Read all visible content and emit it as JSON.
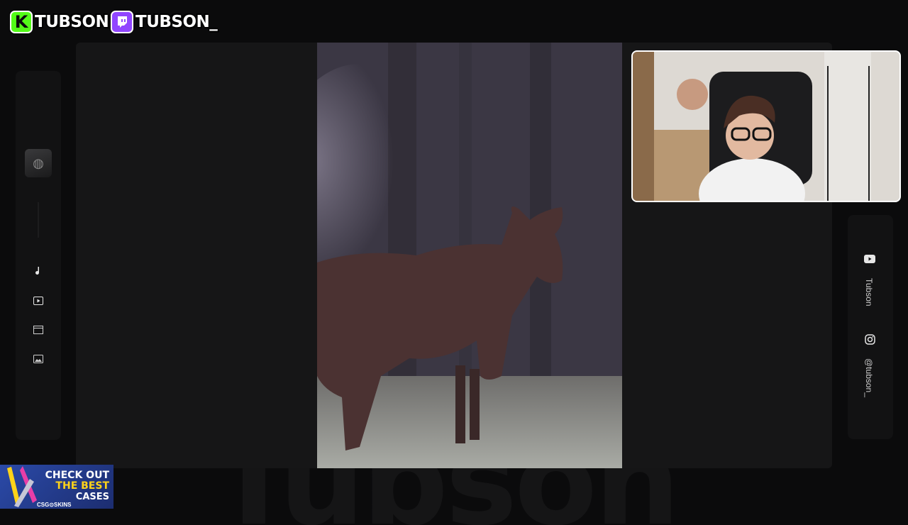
{
  "header": {
    "kick": {
      "badge": "K",
      "handle": "TUBSON",
      "color": "#53fc18"
    },
    "twitch": {
      "badge": "",
      "handle": "TUBSON_",
      "color": "#9146ff"
    }
  },
  "watermark": "Tubson",
  "left_rail": {
    "icons": [
      "avatar-thumbnail",
      "music-note-icon",
      "play-video-icon",
      "clapperboard-icon",
      "image-icon"
    ]
  },
  "right_rail": {
    "youtube": {
      "icon": "youtube-icon",
      "label": "Tubson"
    },
    "instagram": {
      "icon": "instagram-icon",
      "label": "@tubson_"
    }
  },
  "promo": {
    "line1": "CHECK OUT",
    "line2": "THE BEST",
    "line3": "CASES",
    "brand": "CSG⊙SKINS"
  },
  "colors": {
    "background": "#0b0b0c",
    "panel": "#161617",
    "accent_kick": "#53fc18",
    "accent_twitch": "#9146ff",
    "promo_yellow": "#ffd319"
  }
}
